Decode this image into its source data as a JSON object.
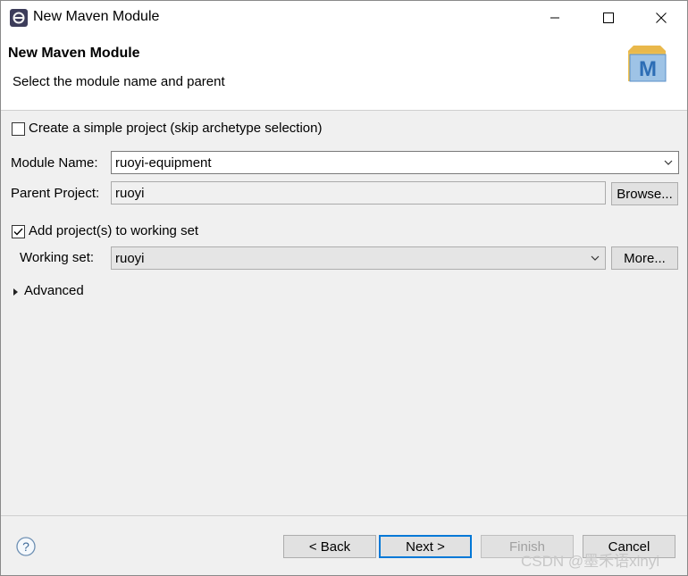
{
  "window": {
    "title": "New Maven Module",
    "app_icon": "eclipse-icon",
    "controls": [
      "minimize-icon",
      "maximize-icon",
      "close-icon"
    ]
  },
  "header": {
    "title": "New Maven Module",
    "description": "Select the module name and parent",
    "logo_letter": "M",
    "logo_icon": "maven-logo-icon"
  },
  "form": {
    "simple_project": {
      "label": "Create a simple project (skip archetype selection)",
      "checked": false
    },
    "module_name": {
      "label": "Module Name:",
      "value": "ruoyi-equipment"
    },
    "parent_project": {
      "label": "Parent Project:",
      "value": "ruoyi",
      "browse_label": "Browse..."
    },
    "working_set_check": {
      "label": "Add project(s) to working set",
      "checked": true
    },
    "working_set": {
      "label": "Working set:",
      "value": "ruoyi",
      "more_label": "More..."
    },
    "advanced": {
      "label": "Advanced",
      "expanded": false
    }
  },
  "footer": {
    "help_icon": "help-icon",
    "back_label": "< Back",
    "next_label": "Next >",
    "finish_label": "Finish",
    "cancel_label": "Cancel"
  },
  "watermark": "CSDN @墨禾语xinyi",
  "colors": {
    "accent": "#0078d7",
    "dialog_bg": "#f0f0f0",
    "header_bg": "#ffffff"
  }
}
